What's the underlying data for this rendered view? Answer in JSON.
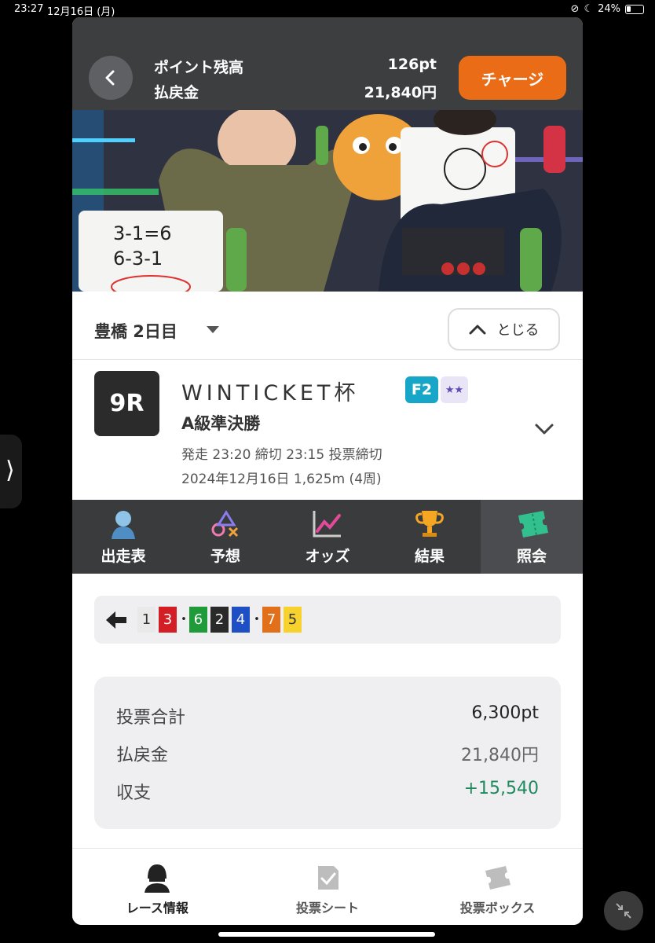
{
  "status": {
    "time": "23:27",
    "date": "12月16日 (月)",
    "battery": "24%"
  },
  "header": {
    "points_label": "ポイント残高",
    "points_value": "126pt",
    "payout_label": "払戻金",
    "payout_value": "21,840円",
    "charge_button": "チャージ"
  },
  "venue": {
    "name": "豊橋 2日目",
    "close_button": "とじる"
  },
  "race": {
    "number": "9R",
    "title": "WINTICKET杯",
    "grade": "F2",
    "star_badge": "★★",
    "class": "A級準決勝",
    "meta1": "発走 23:20 締切 23:15  投票締切",
    "meta2": "2024年12月16日 1,625m (4周)"
  },
  "tabs": [
    {
      "label": "出走表",
      "icon": "rider-icon"
    },
    {
      "label": "予想",
      "icon": "prediction-icon"
    },
    {
      "label": "オッズ",
      "icon": "odds-chart-icon"
    },
    {
      "label": "結果",
      "icon": "trophy-icon"
    },
    {
      "label": "照会",
      "icon": "ticket-icon",
      "active": true
    }
  ],
  "combination": {
    "groups": [
      {
        "num": "1",
        "bg": "#e9e9ea",
        "fg": "#333"
      },
      {
        "num": "3",
        "bg": "#d41e26",
        "fg": "#fff"
      },
      {
        "sep": "•"
      },
      {
        "num": "6",
        "bg": "#1f9b3a",
        "fg": "#fff"
      },
      {
        "num": "2",
        "bg": "#2a2a2a",
        "fg": "#fff"
      },
      {
        "num": "4",
        "bg": "#1f4fc4",
        "fg": "#fff"
      },
      {
        "sep": "•"
      },
      {
        "num": "7",
        "bg": "#e2701b",
        "fg": "#fff"
      },
      {
        "num": "5",
        "bg": "#f7d12e",
        "fg": "#333"
      }
    ]
  },
  "summary": {
    "bet_total_label": "投票合計",
    "bet_total_value": "6,300pt",
    "payout_label": "払戻金",
    "payout_value": "21,840円",
    "balance_label": "収支",
    "balance_value": "+15,540"
  },
  "bottom_nav": [
    {
      "label": "レース情報",
      "icon": "helmet-icon",
      "active": true
    },
    {
      "label": "投票シート",
      "icon": "checksheet-icon"
    },
    {
      "label": "投票ボックス",
      "icon": "ticketbox-icon"
    }
  ],
  "colors": {
    "accent": "#ea6c17",
    "header_bg": "#3d3e40",
    "positive": "#1e8a5e"
  }
}
